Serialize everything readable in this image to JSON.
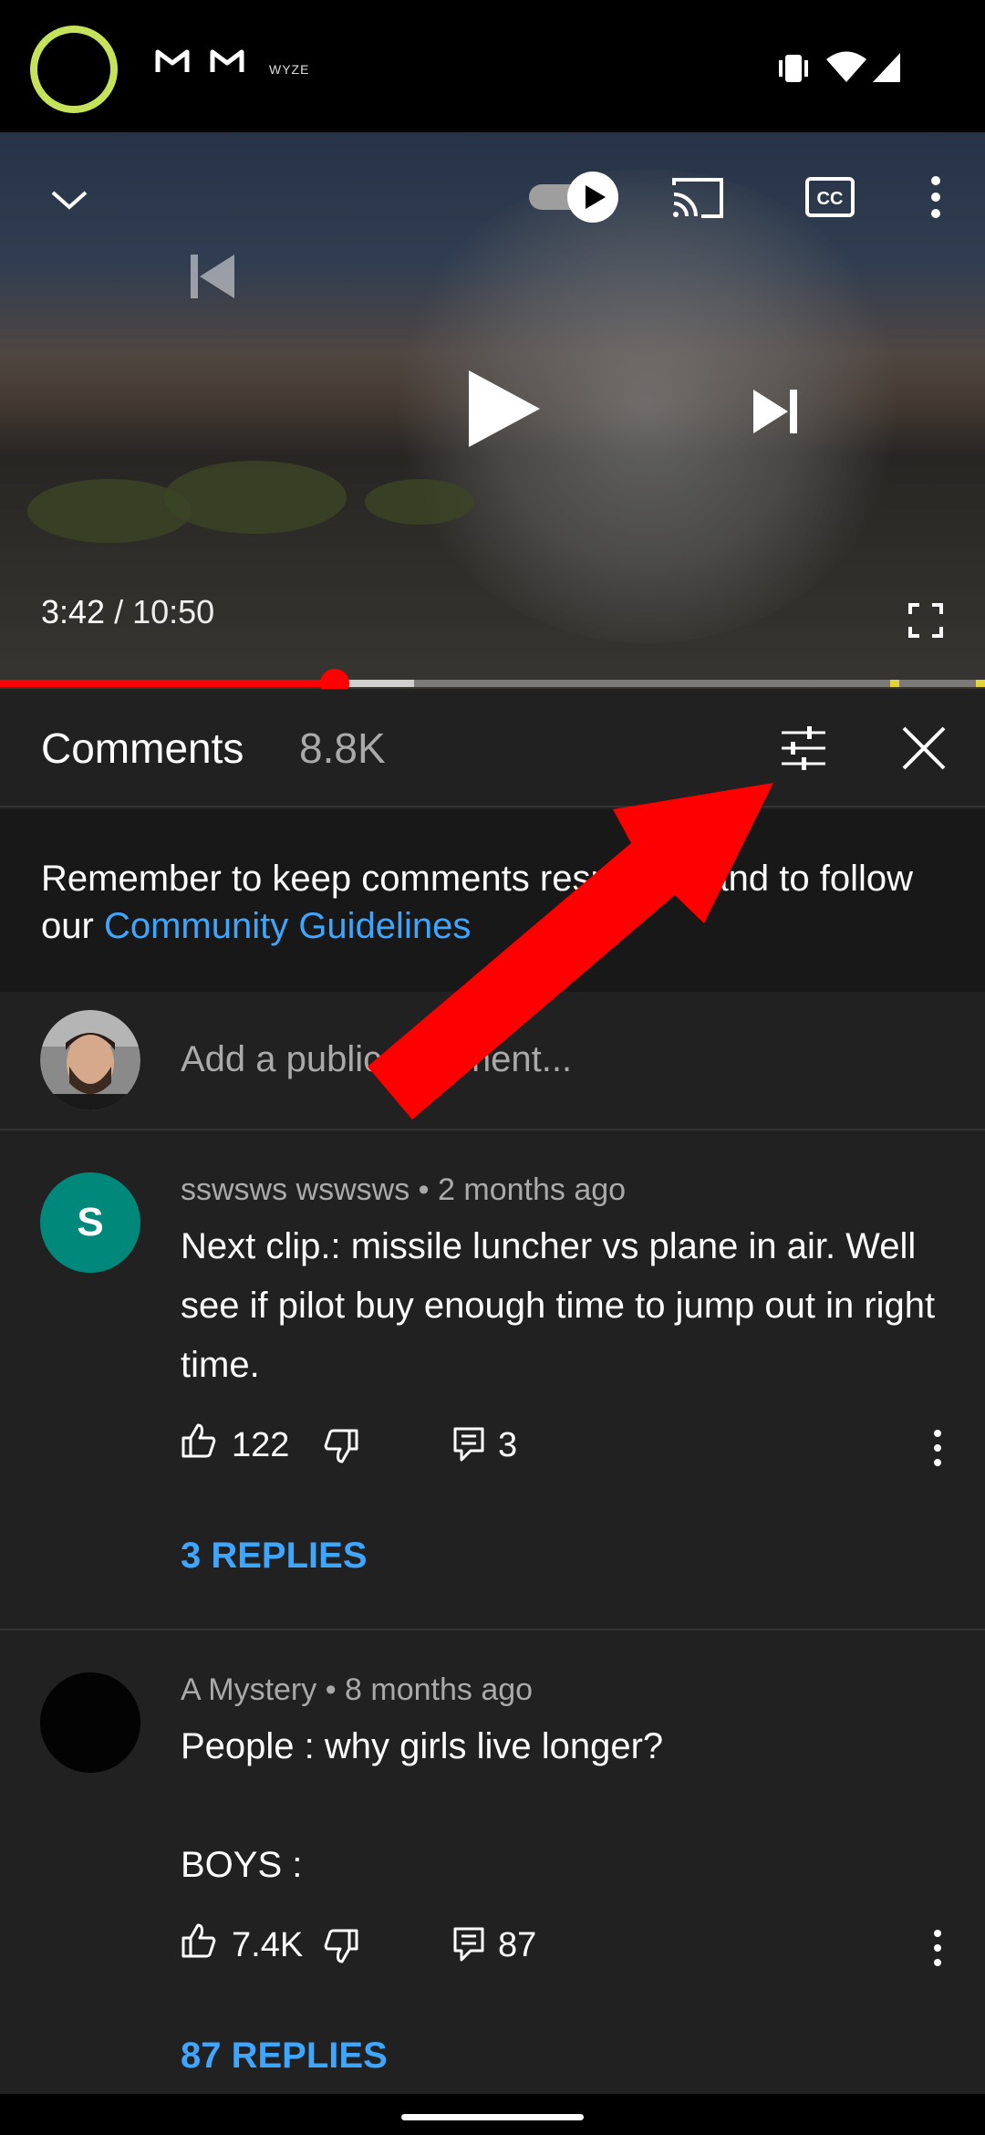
{
  "status_bar": {
    "wyze_label": "WYZE"
  },
  "player": {
    "current_time": "3:42",
    "total_time": "10:50",
    "progress_fraction": 0.34,
    "buffered_fraction": 0.42
  },
  "comments_panel": {
    "title": "Comments",
    "count": "8.8K",
    "notice_prefix": "Remember to keep comments respectful and to follow our ",
    "notice_link": "Community Guidelines",
    "add_placeholder": "Add a public comment..."
  },
  "comments": [
    {
      "avatar_letter": "S",
      "author": "sswsws wswsws",
      "age": "2 months ago",
      "text": "Next clip.: missile luncher vs plane in air. Well see if pilot buy enough time to jump out in right time.",
      "likes": "122",
      "reply_count": "3",
      "replies_label": "3 REPLIES"
    },
    {
      "author": "A Mystery",
      "age": "8 months ago",
      "text_line1": "People : why girls live longer?",
      "text_line2": "BOYS :",
      "likes": "7.4K",
      "reply_count": "87",
      "replies_label": "87 REPLIES"
    }
  ],
  "colors": {
    "accent_red": "#ff0000",
    "link_blue": "#3ea6ff",
    "annotation_arrow": "#ff0000"
  }
}
